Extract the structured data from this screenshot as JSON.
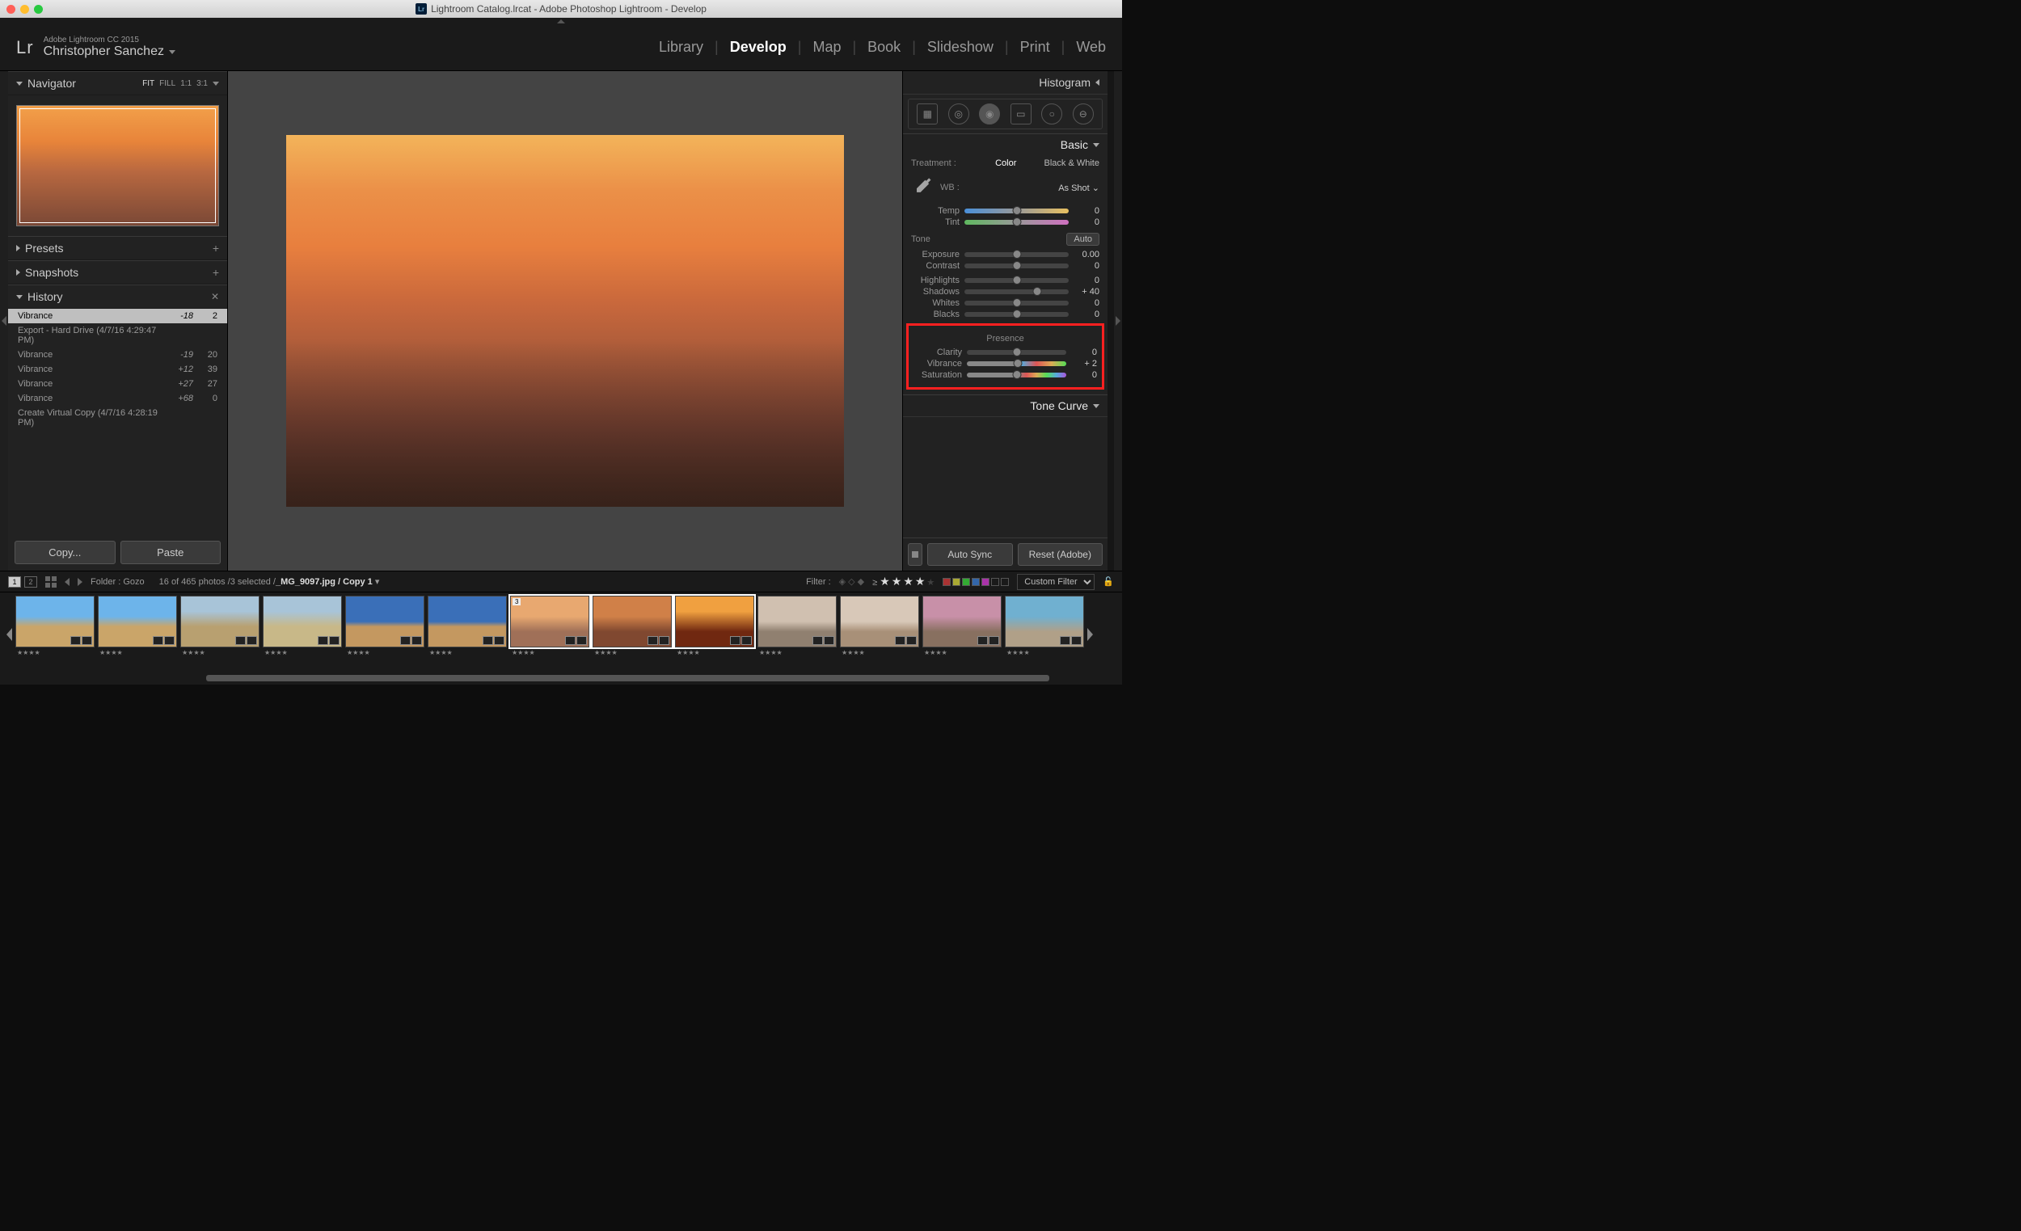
{
  "window": {
    "title": "Lightroom Catalog.lrcat - Adobe Photoshop Lightroom - Develop"
  },
  "header": {
    "logo": "Lr",
    "product": "Adobe Lightroom CC 2015",
    "user": "Christopher Sanchez",
    "modules": [
      "Library",
      "Develop",
      "Map",
      "Book",
      "Slideshow",
      "Print",
      "Web"
    ],
    "active_module": "Develop"
  },
  "left": {
    "navigator": {
      "label": "Navigator",
      "zoom_opts": [
        "FIT",
        "FILL",
        "1:1",
        "3:1"
      ],
      "zoom_sel": "FIT"
    },
    "presets": {
      "label": "Presets"
    },
    "snapshots": {
      "label": "Snapshots"
    },
    "history": {
      "label": "History",
      "items": [
        {
          "name": "Vibrance",
          "v1": "-18",
          "v2": "2",
          "sel": true
        },
        {
          "name": "Export - Hard Drive (4/7/16 4:29:47 PM)",
          "v1": "",
          "v2": ""
        },
        {
          "name": "Vibrance",
          "v1": "-19",
          "v2": "20"
        },
        {
          "name": "Vibrance",
          "v1": "+12",
          "v2": "39"
        },
        {
          "name": "Vibrance",
          "v1": "+27",
          "v2": "27"
        },
        {
          "name": "Vibrance",
          "v1": "+68",
          "v2": "0"
        },
        {
          "name": "Create Virtual Copy (4/7/16 4:28:19 PM)",
          "v1": "",
          "v2": ""
        }
      ]
    },
    "copy": "Copy...",
    "paste": "Paste"
  },
  "right": {
    "histogram": "Histogram",
    "basic": {
      "label": "Basic",
      "treatment_label": "Treatment :",
      "treatment_color": "Color",
      "treatment_bw": "Black & White",
      "wb_label": "WB :",
      "wb_value": "As Shot",
      "temp": {
        "label": "Temp",
        "value": "0",
        "pos": 50
      },
      "tint": {
        "label": "Tint",
        "value": "0",
        "pos": 50
      },
      "tone_label": "Tone",
      "auto": "Auto",
      "exposure": {
        "label": "Exposure",
        "value": "0.00",
        "pos": 50
      },
      "contrast": {
        "label": "Contrast",
        "value": "0",
        "pos": 50
      },
      "highlights": {
        "label": "Highlights",
        "value": "0",
        "pos": 50
      },
      "shadows": {
        "label": "Shadows",
        "value": "+ 40",
        "pos": 70
      },
      "whites": {
        "label": "Whites",
        "value": "0",
        "pos": 50
      },
      "blacks": {
        "label": "Blacks",
        "value": "0",
        "pos": 50
      },
      "presence_label": "Presence",
      "clarity": {
        "label": "Clarity",
        "value": "0",
        "pos": 50
      },
      "vibrance": {
        "label": "Vibrance",
        "value": "+ 2",
        "pos": 51
      },
      "saturation": {
        "label": "Saturation",
        "value": "0",
        "pos": 50
      }
    },
    "tone_curve": "Tone Curve",
    "autosync": "Auto Sync",
    "reset": "Reset (Adobe)"
  },
  "filmstrip": {
    "sec1": "1",
    "sec2": "2",
    "folder_label": "Folder : ",
    "folder": "Gozo",
    "counts": "16 of 465 photos /3 selected /",
    "file": "_MG_9097.jpg / Copy 1",
    "filter_label": "Filter :",
    "custom_filter": "Custom Filter",
    "thumbs": [
      {
        "bg": "linear-gradient(180deg,#6db4ea 40%,#caa569 60%)"
      },
      {
        "bg": "linear-gradient(180deg,#6db4ea 40%,#caa569 60%)"
      },
      {
        "bg": "linear-gradient(180deg,#a8c4d8 30%,#b8a070 60%)"
      },
      {
        "bg": "linear-gradient(180deg,#a8c4d8 30%,#c8b888 60%)"
      },
      {
        "bg": "linear-gradient(180deg,#3a6fb8 50%,#c49860 60%)"
      },
      {
        "bg": "linear-gradient(180deg,#3a6fb8 50%,#c49860 60%)"
      },
      {
        "bg": "linear-gradient(180deg,#e8a870 40%,#a07058 70%)",
        "sel": true,
        "num": "3"
      },
      {
        "bg": "linear-gradient(180deg,#d08048 40%,#804830 70%)",
        "sel": true
      },
      {
        "bg": "linear-gradient(180deg,#f0a040 30%,#702810 70%)",
        "sel": true
      },
      {
        "bg": "linear-gradient(180deg,#d0c0b0 50%,#908070 70%)"
      },
      {
        "bg": "linear-gradient(180deg,#d8c8b8 50%,#a89078 70%)"
      },
      {
        "bg": "linear-gradient(180deg,#c890a8 40%,#887060 70%)"
      },
      {
        "bg": "linear-gradient(180deg,#70b0d0 40%,#b0a088 70%)"
      }
    ]
  }
}
